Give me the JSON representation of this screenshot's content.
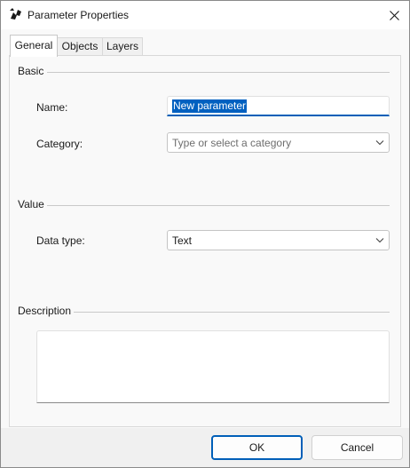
{
  "window": {
    "title": "Parameter Properties"
  },
  "tabs": [
    {
      "label": "General",
      "active": true
    },
    {
      "label": "Objects",
      "active": false
    },
    {
      "label": "Layers",
      "active": false
    }
  ],
  "basic": {
    "heading": "Basic",
    "name_label": "Name:",
    "name_value": "New parameter",
    "category_label": "Category:",
    "category_placeholder": "Type or select a category"
  },
  "value_group": {
    "heading": "Value",
    "data_type_label": "Data type:",
    "data_type_value": "Text"
  },
  "description": {
    "heading": "Description",
    "value": ""
  },
  "buttons": {
    "ok": "OK",
    "cancel": "Cancel"
  },
  "colors": {
    "accent": "#005fb8",
    "selection": "#0060c0"
  },
  "icons": {
    "app": "rhino-app-icon",
    "close": "close-icon",
    "dropdown": "chevron-down-icon"
  }
}
